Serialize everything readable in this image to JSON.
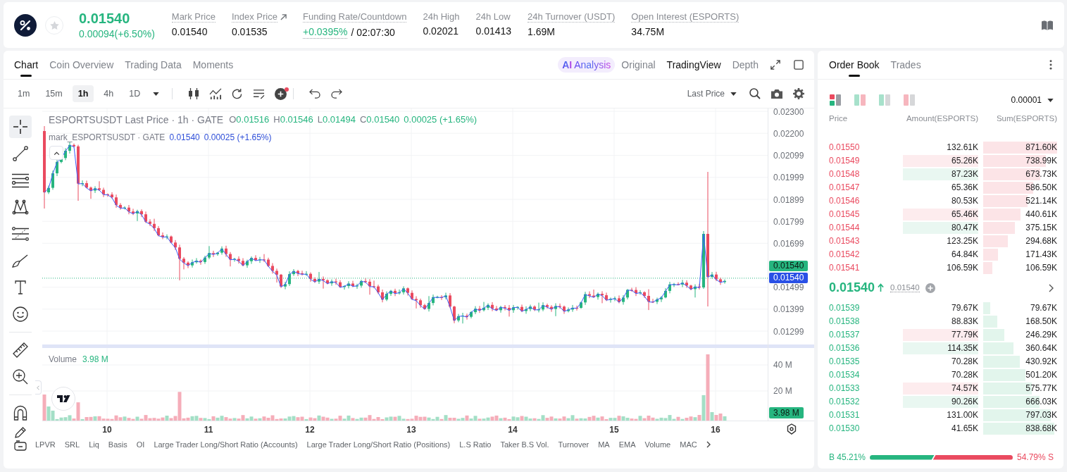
{
  "header": {
    "price": "0.01540",
    "change": "0.00094(+6.50%)",
    "favorite": false,
    "stats": [
      {
        "label": "Mark Price",
        "value": "0.01540",
        "kind": "plain",
        "tooltip": true
      },
      {
        "label": "Index Price",
        "value": "0.01535",
        "kind": "link",
        "tooltip": true
      },
      {
        "label": "Funding Rate/Countdown",
        "value": "+0.0395%",
        "countdown": "/ 02:07:30",
        "kind": "funding",
        "tooltip": true
      },
      {
        "label": "24h High",
        "value": "0.02021",
        "kind": "plain",
        "tooltip": false
      },
      {
        "label": "24h Low",
        "value": "0.01413",
        "kind": "plain",
        "tooltip": false
      },
      {
        "label": "24h Turnover (USDT)",
        "value": "1.69M",
        "kind": "plain",
        "tooltip": true
      },
      {
        "label": "Open Interest (ESPORTS)",
        "value": "34.75M",
        "kind": "plain",
        "tooltip": true
      }
    ]
  },
  "chart_panel": {
    "tabs": [
      {
        "label": "Chart",
        "selected": true
      },
      {
        "label": "Coin Overview",
        "selected": false
      },
      {
        "label": "Trading Data",
        "selected": false
      },
      {
        "label": "Moments",
        "selected": false
      }
    ],
    "views": [
      {
        "label": "Analysis",
        "prefix": "AI",
        "kind": "ai",
        "selected": false
      },
      {
        "label": "Original",
        "kind": "plain",
        "selected": false
      },
      {
        "label": "TradingView",
        "kind": "plain",
        "selected": true
      },
      {
        "label": "Depth",
        "kind": "plain",
        "selected": false
      }
    ],
    "timeframes": [
      {
        "label": "1m",
        "selected": false
      },
      {
        "label": "15m",
        "selected": false
      },
      {
        "label": "1h",
        "selected": true
      },
      {
        "label": "4h",
        "selected": false
      },
      {
        "label": "1D",
        "selected": false
      }
    ],
    "toolbar": {
      "alert_dot": true
    },
    "price_source": "Last Price",
    "tool_groups": [
      {
        "tools": [
          {
            "kind": "crosshair",
            "selected": true
          },
          {
            "kind": "trend_line",
            "selected": false
          },
          {
            "kind": "channel",
            "selected": false
          },
          {
            "kind": "pattern",
            "selected": false
          },
          {
            "kind": "fib",
            "selected": false
          },
          {
            "kind": "brush",
            "selected": false
          },
          {
            "kind": "text",
            "selected": false
          },
          {
            "kind": "emoji",
            "selected": false
          }
        ]
      },
      {
        "tools": [
          {
            "kind": "ruler",
            "selected": false
          },
          {
            "kind": "zoom",
            "selected": false
          }
        ]
      },
      {
        "tools": [
          {
            "kind": "magnet",
            "selected": false
          },
          {
            "kind": "pencil",
            "selected": false
          },
          {
            "kind": "frame",
            "selected": false
          }
        ]
      }
    ],
    "legend": {
      "title": "ESPORTSUSDT Last Price · 1h · GATE",
      "rising": true,
      "ohlc": [
        {
          "key": "O",
          "value": "0.01516"
        },
        {
          "key": "H",
          "value": "0.01546"
        },
        {
          "key": "L",
          "value": "0.01494"
        },
        {
          "key": "C",
          "value": "0.01540"
        }
      ],
      "change": "0.00025 (+1.65%)"
    },
    "mark_legend": {
      "title": "mark_ESPORTSUSDT · GATE",
      "value": "0.01540",
      "change": "0.00025 (+1.65%)"
    },
    "price_axis": [
      "0.02300",
      "0.02200",
      "0.02099",
      "0.01999",
      "0.01899",
      "0.01799",
      "0.01699",
      "0.01499",
      "0.01399",
      "0.01299"
    ],
    "price_tags": [
      {
        "label": "0.01540",
        "kind": "last"
      },
      {
        "label": "0.01540",
        "kind": "mark"
      }
    ],
    "volume": {
      "title": "Volume",
      "value": "3.98 M",
      "axis": [
        "40 M",
        "20 M"
      ],
      "tag": "3.98 M"
    },
    "time_axis": [
      "10",
      "11",
      "12",
      "13",
      "14",
      "15",
      "16"
    ],
    "indicators": [
      "LPVR",
      "SRL",
      "Liq",
      "Basis",
      "OI",
      "Large Trader Long/Short Ratio (Accounts)",
      "Large Trader Long/Short Ratio (Positions)",
      "L.S Ratio",
      "Taker B.S Vol.",
      "Turnover",
      "MA",
      "EMA",
      "Volume",
      "MAC"
    ]
  },
  "order_book": {
    "tabs": [
      {
        "label": "Order Book",
        "selected": true
      },
      {
        "label": "Trades",
        "selected": false
      }
    ],
    "layouts": [
      {
        "kind": "both",
        "selected": true
      },
      {
        "kind": "split",
        "selected": false
      },
      {
        "kind": "bids",
        "selected": false
      },
      {
        "kind": "asks",
        "selected": false
      }
    ],
    "precision": "0.00001",
    "columns": [
      "Price",
      "Amount(ESPORTS)",
      "Sum(ESPORTS)"
    ],
    "asks": [
      {
        "price": "0.01550",
        "amount": "132.61K",
        "sum": "871.60K",
        "kind": "plain"
      },
      {
        "price": "0.01549",
        "amount": "65.26K",
        "sum": "738.99K",
        "kind": "flash_down"
      },
      {
        "price": "0.01548",
        "amount": "87.23K",
        "sum": "673.73K",
        "kind": "flash_up"
      },
      {
        "price": "0.01547",
        "amount": "65.36K",
        "sum": "586.50K",
        "kind": "plain"
      },
      {
        "price": "0.01546",
        "amount": "80.53K",
        "sum": "521.14K",
        "kind": "plain"
      },
      {
        "price": "0.01545",
        "amount": "65.46K",
        "sum": "440.61K",
        "kind": "flash_down"
      },
      {
        "price": "0.01544",
        "amount": "80.47K",
        "sum": "375.15K",
        "kind": "flash_up"
      },
      {
        "price": "0.01543",
        "amount": "123.25K",
        "sum": "294.68K",
        "kind": "plain"
      },
      {
        "price": "0.01542",
        "amount": "64.84K",
        "sum": "171.43K",
        "kind": "plain"
      },
      {
        "price": "0.01541",
        "amount": "106.59K",
        "sum": "106.59K",
        "kind": "plain"
      }
    ],
    "last": {
      "price": "0.01540",
      "rising": true,
      "mark": "0.01540"
    },
    "bids": [
      {
        "price": "0.01539",
        "amount": "79.67K",
        "sum": "79.67K",
        "kind": "plain"
      },
      {
        "price": "0.01538",
        "amount": "88.83K",
        "sum": "168.50K",
        "kind": "plain"
      },
      {
        "price": "0.01537",
        "amount": "77.79K",
        "sum": "246.29K",
        "kind": "flash_down"
      },
      {
        "price": "0.01536",
        "amount": "114.35K",
        "sum": "360.64K",
        "kind": "flash_up"
      },
      {
        "price": "0.01535",
        "amount": "70.28K",
        "sum": "430.92K",
        "kind": "plain"
      },
      {
        "price": "0.01534",
        "amount": "70.28K",
        "sum": "501.20K",
        "kind": "plain"
      },
      {
        "price": "0.01533",
        "amount": "74.57K",
        "sum": "575.77K",
        "kind": "flash_down"
      },
      {
        "price": "0.01532",
        "amount": "90.26K",
        "sum": "666.03K",
        "kind": "flash_up"
      },
      {
        "price": "0.01531",
        "amount": "131.00K",
        "sum": "797.03K",
        "kind": "plain"
      },
      {
        "price": "0.01530",
        "amount": "41.65K",
        "sum": "838.68K",
        "kind": "plain"
      }
    ],
    "ratio": {
      "buy": "B 45.21%",
      "sell": "54.79% S"
    }
  }
}
